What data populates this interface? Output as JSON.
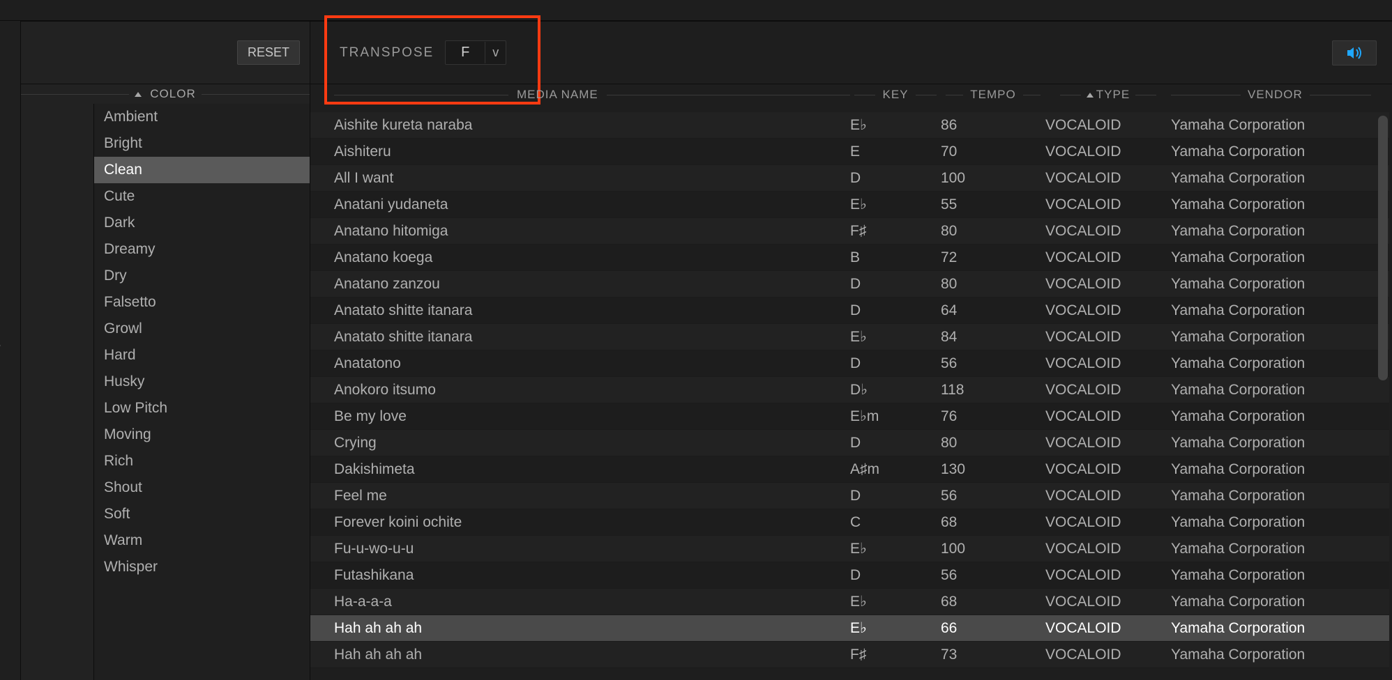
{
  "buttons": {
    "reset": "RESET"
  },
  "transpose": {
    "label": "TRANSPOSE",
    "value": "F",
    "chevron": "v"
  },
  "filters": {
    "header": "COLOR",
    "items": [
      {
        "label": "Ambient",
        "selected": false
      },
      {
        "label": "Bright",
        "selected": false
      },
      {
        "label": "Clean",
        "selected": true
      },
      {
        "label": "Cute",
        "selected": false
      },
      {
        "label": "Dark",
        "selected": false
      },
      {
        "label": "Dreamy",
        "selected": false
      },
      {
        "label": "Dry",
        "selected": false
      },
      {
        "label": "Falsetto",
        "selected": false
      },
      {
        "label": "Growl",
        "selected": false
      },
      {
        "label": "Hard",
        "selected": false
      },
      {
        "label": "Husky",
        "selected": false
      },
      {
        "label": "Low Pitch",
        "selected": false
      },
      {
        "label": "Moving",
        "selected": false
      },
      {
        "label": "Rich",
        "selected": false
      },
      {
        "label": "Shout",
        "selected": false
      },
      {
        "label": "Soft",
        "selected": false
      },
      {
        "label": "Warm",
        "selected": false
      },
      {
        "label": "Whisper",
        "selected": false
      }
    ]
  },
  "left_fragment": "e",
  "columns": {
    "media": "MEDIA NAME",
    "key": "KEY",
    "tempo": "TEMPO",
    "type": "TYPE",
    "vendor": "VENDOR"
  },
  "rows": [
    {
      "name": "Aishite kureta naraba",
      "key": "E♭",
      "tempo": "86",
      "type": "VOCALOID",
      "vendor": "Yamaha Corporation",
      "selected": false
    },
    {
      "name": "Aishiteru",
      "key": "E",
      "tempo": "70",
      "type": "VOCALOID",
      "vendor": "Yamaha Corporation",
      "selected": false
    },
    {
      "name": "All I want",
      "key": "D",
      "tempo": "100",
      "type": "VOCALOID",
      "vendor": "Yamaha Corporation",
      "selected": false
    },
    {
      "name": "Anatani yudaneta",
      "key": "E♭",
      "tempo": "55",
      "type": "VOCALOID",
      "vendor": "Yamaha Corporation",
      "selected": false
    },
    {
      "name": "Anatano hitomiga",
      "key": "F♯",
      "tempo": "80",
      "type": "VOCALOID",
      "vendor": "Yamaha Corporation",
      "selected": false
    },
    {
      "name": "Anatano koega",
      "key": "B",
      "tempo": "72",
      "type": "VOCALOID",
      "vendor": "Yamaha Corporation",
      "selected": false
    },
    {
      "name": "Anatano zanzou",
      "key": "D",
      "tempo": "80",
      "type": "VOCALOID",
      "vendor": "Yamaha Corporation",
      "selected": false
    },
    {
      "name": "Anatato shitte itanara",
      "key": "D",
      "tempo": "64",
      "type": "VOCALOID",
      "vendor": "Yamaha Corporation",
      "selected": false
    },
    {
      "name": "Anatato shitte itanara",
      "key": "E♭",
      "tempo": "84",
      "type": "VOCALOID",
      "vendor": "Yamaha Corporation",
      "selected": false
    },
    {
      "name": "Anatatono",
      "key": "D",
      "tempo": "56",
      "type": "VOCALOID",
      "vendor": "Yamaha Corporation",
      "selected": false
    },
    {
      "name": "Anokoro itsumo",
      "key": "D♭",
      "tempo": "118",
      "type": "VOCALOID",
      "vendor": "Yamaha Corporation",
      "selected": false
    },
    {
      "name": "Be my love",
      "key": "E♭m",
      "tempo": "76",
      "type": "VOCALOID",
      "vendor": "Yamaha Corporation",
      "selected": false
    },
    {
      "name": "Crying",
      "key": "D",
      "tempo": "80",
      "type": "VOCALOID",
      "vendor": "Yamaha Corporation",
      "selected": false
    },
    {
      "name": "Dakishimeta",
      "key": "A♯m",
      "tempo": "130",
      "type": "VOCALOID",
      "vendor": "Yamaha Corporation",
      "selected": false
    },
    {
      "name": "Feel me",
      "key": "D",
      "tempo": "56",
      "type": "VOCALOID",
      "vendor": "Yamaha Corporation",
      "selected": false
    },
    {
      "name": "Forever koini ochite",
      "key": "C",
      "tempo": "68",
      "type": "VOCALOID",
      "vendor": "Yamaha Corporation",
      "selected": false
    },
    {
      "name": "Fu-u-wo-u-u",
      "key": "E♭",
      "tempo": "100",
      "type": "VOCALOID",
      "vendor": "Yamaha Corporation",
      "selected": false
    },
    {
      "name": "Futashikana",
      "key": "D",
      "tempo": "56",
      "type": "VOCALOID",
      "vendor": "Yamaha Corporation",
      "selected": false
    },
    {
      "name": "Ha-a-a-a",
      "key": "E♭",
      "tempo": "68",
      "type": "VOCALOID",
      "vendor": "Yamaha Corporation",
      "selected": false
    },
    {
      "name": "Hah ah ah ah",
      "key": "E♭",
      "tempo": "66",
      "type": "VOCALOID",
      "vendor": "Yamaha Corporation",
      "selected": true
    },
    {
      "name": "Hah ah ah ah",
      "key": "F♯",
      "tempo": "73",
      "type": "VOCALOID",
      "vendor": "Yamaha Corporation",
      "selected": false
    }
  ]
}
